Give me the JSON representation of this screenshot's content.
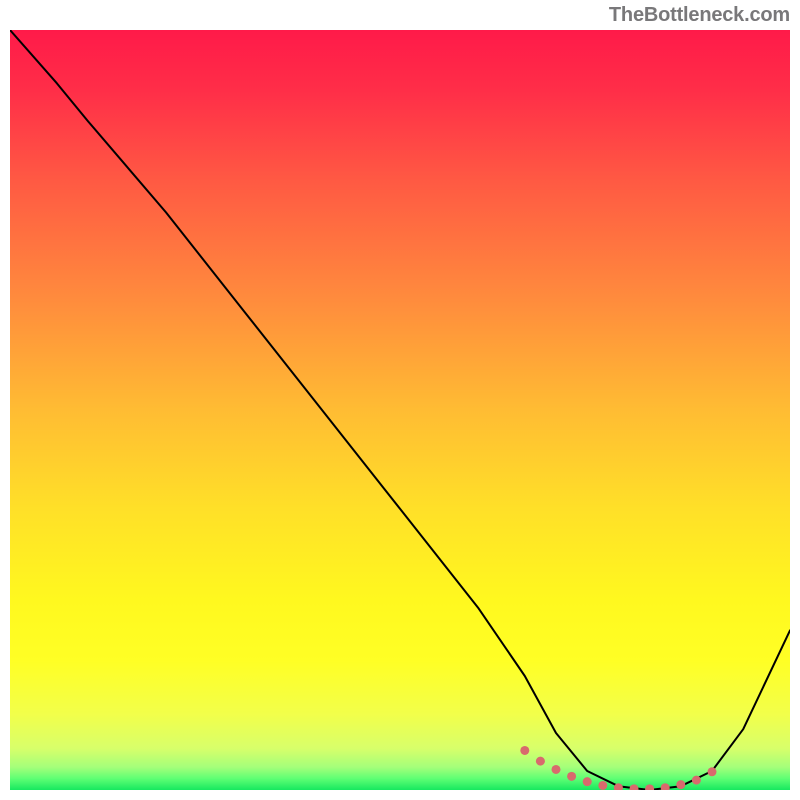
{
  "attribution": "TheBottleneck.com",
  "chart_data": {
    "type": "line",
    "title": "",
    "xlabel": "",
    "ylabel": "",
    "xlim": [
      0,
      100
    ],
    "ylim": [
      0,
      100
    ],
    "series": [
      {
        "name": "bottleneck-curve",
        "x": [
          0,
          6,
          10,
          20,
          30,
          40,
          50,
          60,
          66,
          70,
          74,
          78,
          82,
          86,
          90,
          94,
          100
        ],
        "y": [
          100,
          93,
          88,
          76,
          63,
          50,
          37,
          24,
          15,
          7.5,
          2.5,
          0.5,
          0,
          0.5,
          2.5,
          8,
          21
        ],
        "stroke": "#000000",
        "stroke_width": 2
      },
      {
        "name": "optimal-band",
        "x": [
          66,
          68,
          70,
          72,
          74,
          76,
          78,
          80,
          82,
          84,
          86,
          88,
          90
        ],
        "y": [
          5.2,
          3.8,
          2.7,
          1.8,
          1.1,
          0.6,
          0.3,
          0.15,
          0.15,
          0.3,
          0.7,
          1.3,
          2.4
        ],
        "stroke": "#d86a6d",
        "stroke_width": 9,
        "dotted": true
      }
    ],
    "gradient_stops": [
      {
        "offset": 0.0,
        "color": "#ff1a49"
      },
      {
        "offset": 0.08,
        "color": "#ff2e48"
      },
      {
        "offset": 0.2,
        "color": "#ff5a43"
      },
      {
        "offset": 0.35,
        "color": "#ff8a3d"
      },
      {
        "offset": 0.5,
        "color": "#ffbc33"
      },
      {
        "offset": 0.63,
        "color": "#ffe028"
      },
      {
        "offset": 0.75,
        "color": "#fff81f"
      },
      {
        "offset": 0.83,
        "color": "#ffff25"
      },
      {
        "offset": 0.9,
        "color": "#f2ff4a"
      },
      {
        "offset": 0.945,
        "color": "#d8ff6a"
      },
      {
        "offset": 0.97,
        "color": "#a4ff7a"
      },
      {
        "offset": 0.985,
        "color": "#5eff74"
      },
      {
        "offset": 1.0,
        "color": "#17e85f"
      }
    ]
  }
}
